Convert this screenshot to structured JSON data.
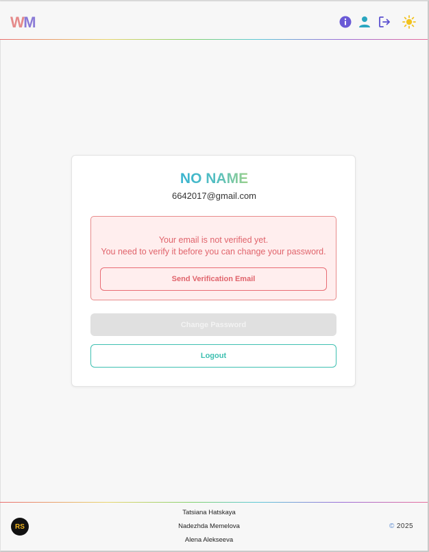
{
  "header": {
    "logo": {
      "letter1": "W",
      "letter2": "M"
    },
    "icons": [
      "info-icon",
      "user-icon",
      "logout-icon",
      "sun-icon"
    ]
  },
  "profile": {
    "name": "NO NAME",
    "email": "6642017@gmail.com"
  },
  "alert": {
    "line1": "Your email is not verified yet.",
    "line2": "You need to verify it before you can change your password.",
    "button": "Send Verification Email"
  },
  "buttons": {
    "change_password": "Change Password",
    "logout": "Logout"
  },
  "footer": {
    "badge": "RS",
    "authors": [
      "Tatsiana Hatskaya",
      "Nadezhda Memelova",
      "Alena Alekseeva"
    ],
    "copyright_symbol": "©",
    "year": "2025"
  },
  "colors": {
    "accent_teal": "#3cbfb0",
    "error_red": "#e0636b",
    "error_bg": "#ffeeee",
    "info_purple": "#6a5ad6",
    "user_teal": "#2aa6c0",
    "sun_yellow": "#f2c21e"
  }
}
